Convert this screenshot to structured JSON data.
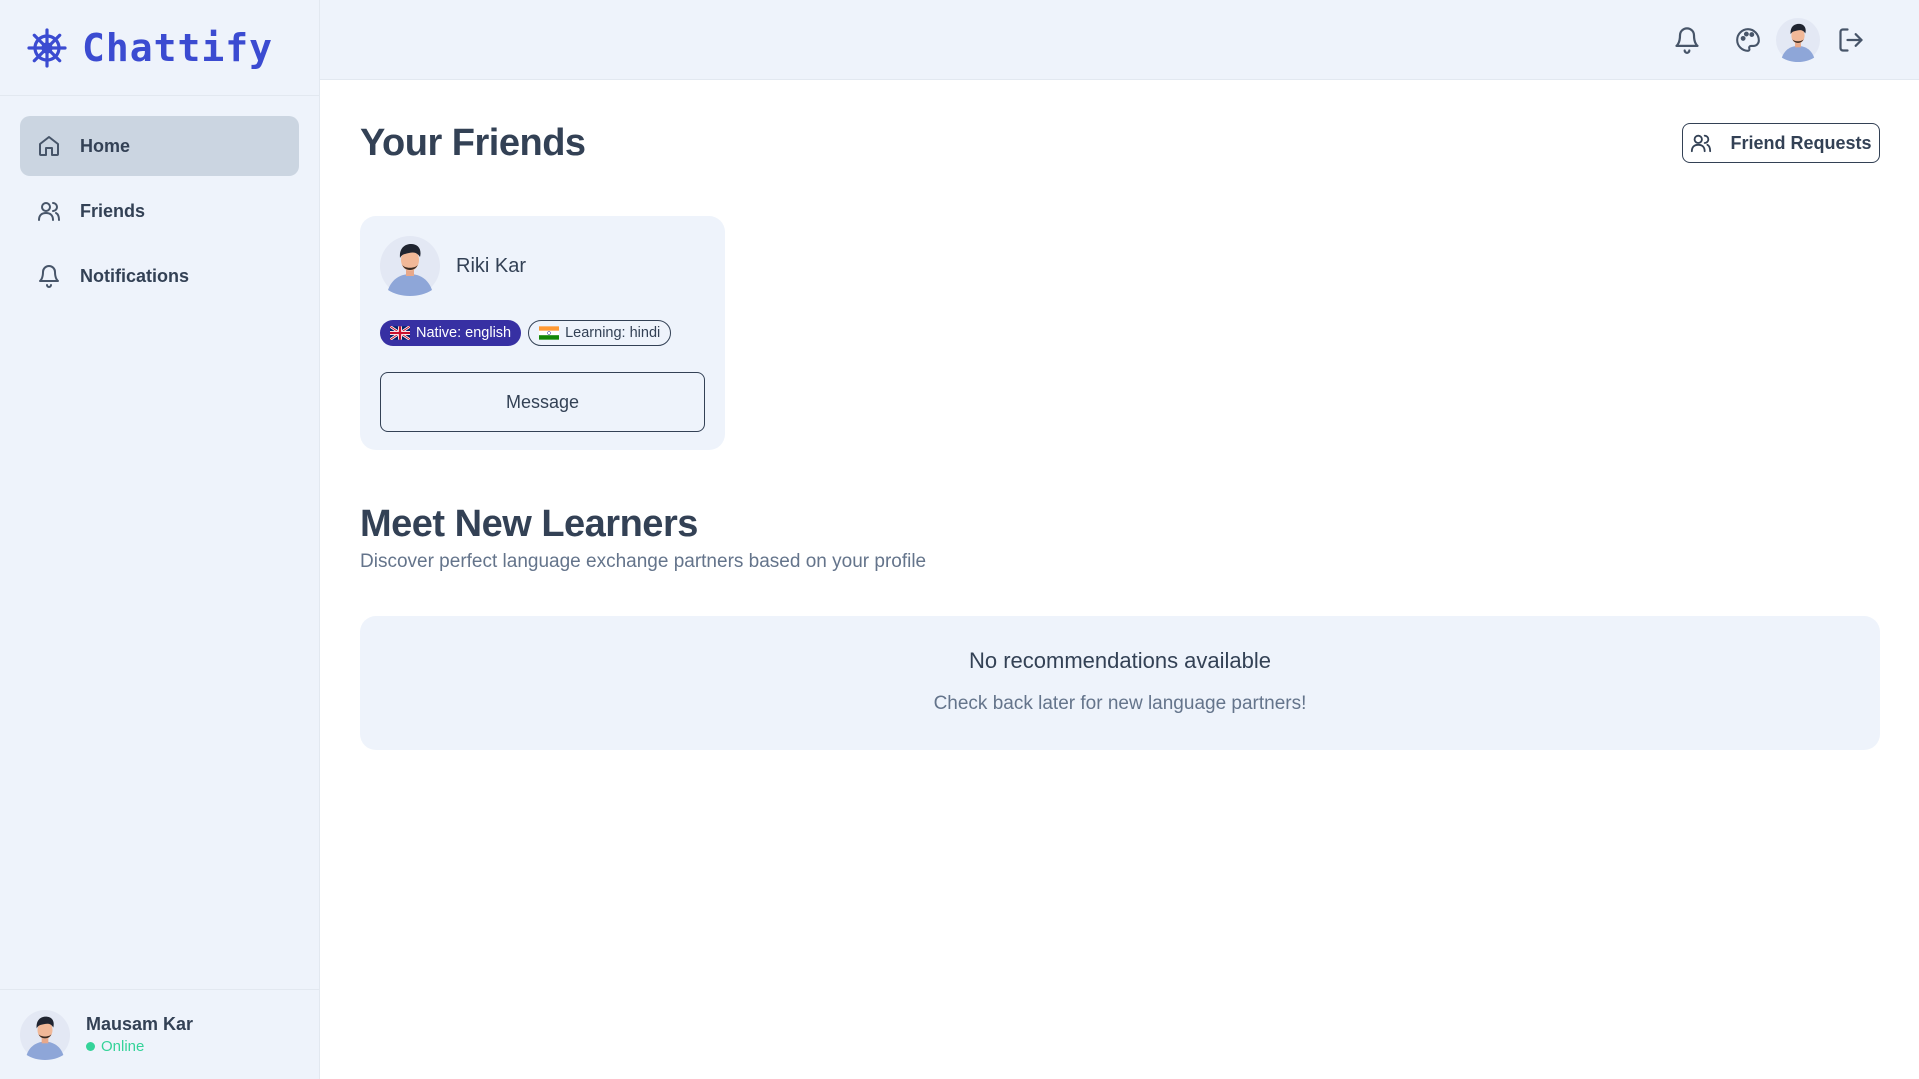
{
  "app": {
    "name": "Chattify",
    "logo_icon": "ship-wheel-icon",
    "accent_color": "#3b4bd1"
  },
  "sidebar": {
    "items": [
      {
        "label": "Home",
        "icon": "home-icon",
        "active": true
      },
      {
        "label": "Friends",
        "icon": "users-icon",
        "active": false
      },
      {
        "label": "Notifications",
        "icon": "bell-icon",
        "active": false
      }
    ]
  },
  "current_user": {
    "name": "Mausam Kar",
    "status": "Online",
    "status_color": "#34d399"
  },
  "topbar": {
    "icons": [
      "bell-icon",
      "palette-icon",
      "avatar",
      "logout-icon"
    ]
  },
  "friends_section": {
    "title": "Your Friends",
    "friend_requests_label": "Friend Requests",
    "friends": [
      {
        "name": "Riki Kar",
        "native_label": "Native: english",
        "native_flag": "gb-flag-icon",
        "learning_label": "Learning: hindi",
        "learning_flag": "in-flag-icon",
        "message_label": "Message"
      }
    ]
  },
  "learners_section": {
    "title": "Meet New Learners",
    "subtitle": "Discover perfect language exchange partners based on your profile",
    "empty_title": "No recommendations available",
    "empty_subtitle": "Check back later for new language partners!"
  }
}
